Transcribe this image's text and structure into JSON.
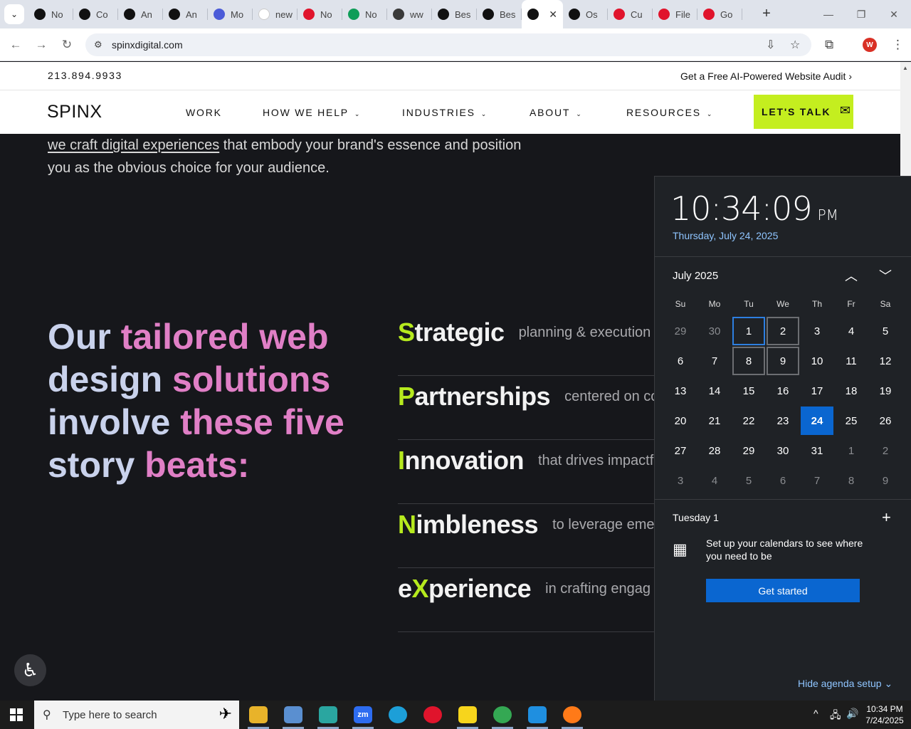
{
  "browser": {
    "tabs": [
      {
        "title": "No",
        "icon": "openai-icon",
        "color": "#111111"
      },
      {
        "title": "Co",
        "icon": "openai-icon",
        "color": "#111111"
      },
      {
        "title": "An",
        "icon": "openai-icon",
        "color": "#111111"
      },
      {
        "title": "An",
        "icon": "openai-icon",
        "color": "#111111"
      },
      {
        "title": "Mo",
        "icon": "makemusic-icon",
        "color": "#4b5bd8"
      },
      {
        "title": "new",
        "icon": "google-icon",
        "color": "#ffffff"
      },
      {
        "title": "No",
        "icon": "youtube-icon",
        "color": "#e0142c"
      },
      {
        "title": "No",
        "icon": "webflow-icon",
        "color": "#0f9d58"
      },
      {
        "title": "ww",
        "icon": "linkedin-icon",
        "color": "#3a3a3a"
      },
      {
        "title": "Bes",
        "icon": "x-icon",
        "color": "#111111"
      },
      {
        "title": "Bes",
        "icon": "x-icon",
        "color": "#111111"
      },
      {
        "title": "",
        "icon": "x-icon",
        "color": "#111111",
        "active": true
      },
      {
        "title": "Os",
        "icon": "asterisk-icon",
        "color": "#111111"
      },
      {
        "title": "Cu",
        "icon": "diamond-icon",
        "color": "#e0142c"
      },
      {
        "title": "File",
        "icon": "diamond-icon",
        "color": "#e0142c"
      },
      {
        "title": "Go",
        "icon": "diamond-icon",
        "color": "#e0142c"
      }
    ],
    "url": "spinxdigital.com",
    "profile_initial": "W"
  },
  "site": {
    "phone": "213.894.9933",
    "audit_link": "Get a Free AI-Powered Website Audit",
    "logo": "SPINX",
    "nav": [
      "WORK",
      "HOW WE HELP",
      "INDUSTRIES",
      "ABOUT",
      "RESOURCES"
    ],
    "cta": "LET'S TALK",
    "intro_link": "we craft digital experiences",
    "intro_rest": " that embody your brand's essence and position you as the obvious choice for your audience.",
    "headline": {
      "p1": "Our ",
      "h1": "tailored web",
      "p2": " design ",
      "h2": "solutions",
      "p3": " involve ",
      "h3": "these five",
      "p4": " story ",
      "h4": "beats:"
    },
    "beats": [
      {
        "accent": "S",
        "rest": "trategic",
        "desc": "planning & execution"
      },
      {
        "accent": "P",
        "rest": "artnerships",
        "desc": "centered on co"
      },
      {
        "accent": "I",
        "rest": "nnovation",
        "desc": "that drives impactf"
      },
      {
        "accent": "N",
        "rest": "imbleness",
        "desc": "to leverage emer"
      },
      {
        "pre": "e",
        "accent": "X",
        "rest": "perience",
        "desc": "in crafting engag"
      }
    ],
    "colors": {
      "accent_green": "#c4ee1f",
      "headline_pink": "#e07fc6",
      "headline_blue": "#c9d2ec"
    }
  },
  "calendar": {
    "time": "10:34:09",
    "ampm": "PM",
    "date": "Thursday, July 24, 2025",
    "month_label": "July 2025",
    "weekdays": [
      "Su",
      "Mo",
      "Tu",
      "We",
      "Th",
      "Fr",
      "Sa"
    ],
    "days": [
      {
        "d": "29",
        "m": true
      },
      {
        "d": "30",
        "m": true
      },
      {
        "d": "1",
        "s": "outline-blue"
      },
      {
        "d": "2",
        "s": "outline"
      },
      {
        "d": "3"
      },
      {
        "d": "4"
      },
      {
        "d": "5"
      },
      {
        "d": "6"
      },
      {
        "d": "7"
      },
      {
        "d": "8",
        "s": "outline"
      },
      {
        "d": "9",
        "s": "outline"
      },
      {
        "d": "10"
      },
      {
        "d": "11"
      },
      {
        "d": "12"
      },
      {
        "d": "13"
      },
      {
        "d": "14"
      },
      {
        "d": "15"
      },
      {
        "d": "16"
      },
      {
        "d": "17"
      },
      {
        "d": "18"
      },
      {
        "d": "19"
      },
      {
        "d": "20"
      },
      {
        "d": "21"
      },
      {
        "d": "22"
      },
      {
        "d": "23"
      },
      {
        "d": "24",
        "s": "today"
      },
      {
        "d": "25"
      },
      {
        "d": "26"
      },
      {
        "d": "27"
      },
      {
        "d": "28"
      },
      {
        "d": "29"
      },
      {
        "d": "30"
      },
      {
        "d": "31"
      },
      {
        "d": "1",
        "m": true
      },
      {
        "d": "2",
        "m": true
      },
      {
        "d": "3",
        "m": true
      },
      {
        "d": "4",
        "m": true
      },
      {
        "d": "5",
        "m": true
      },
      {
        "d": "6",
        "m": true
      },
      {
        "d": "7",
        "m": true
      },
      {
        "d": "8",
        "m": true
      },
      {
        "d": "9",
        "m": true
      }
    ],
    "agenda_day": "Tuesday 1",
    "agenda_message": "Set up your calendars to see where you need to be",
    "get_started": "Get started",
    "hide_agenda": "Hide agenda setup"
  },
  "taskbar": {
    "search_placeholder": "Type here to search",
    "clock_time": "10:34 PM",
    "clock_date": "7/24/2025",
    "apps": [
      {
        "name": "file-explorer-icon",
        "label": "",
        "color": "#e8b32a"
      },
      {
        "name": "paint-icon",
        "label": "",
        "color": "#5a8fd0"
      },
      {
        "name": "app-diamond-icon",
        "label": "",
        "color": "#2aa6a0"
      },
      {
        "name": "zoom-icon",
        "label": "zm",
        "color": "#2d6cf0"
      },
      {
        "name": "edge-icon",
        "label": "",
        "color": "#1d9fd8"
      },
      {
        "name": "opera-icon",
        "label": "",
        "color": "#e0142c"
      },
      {
        "name": "sticky-notes-icon",
        "label": "",
        "color": "#f7d51c"
      },
      {
        "name": "chrome-icon",
        "label": "",
        "color": "#34a853"
      },
      {
        "name": "vscode-icon",
        "label": "",
        "color": "#1f8fe0"
      },
      {
        "name": "firefox-icon",
        "label": "",
        "color": "#ff7a18"
      }
    ]
  }
}
